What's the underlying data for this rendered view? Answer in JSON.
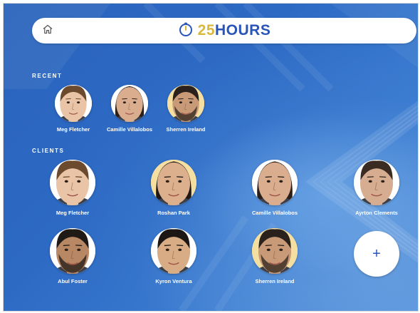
{
  "header": {
    "home_icon": "home-icon",
    "logo_icon": "stopwatch-icon",
    "brand_number": "25",
    "brand_word": "HOURS"
  },
  "recent": {
    "label": "RECENT",
    "people": [
      {
        "name": "Meg Fletcher",
        "bg": "#ffffff",
        "skin": "#e9c4a6",
        "hair": "#6b4a2e",
        "hair_style": "short"
      },
      {
        "name": "Camille Villalobos",
        "bg": "#ffffff",
        "skin": "#d9ad8e",
        "hair": "#2b2019",
        "hair_style": "long"
      },
      {
        "name": "Sherren Ireland",
        "bg": "#f5dfa0",
        "skin": "#c99a78",
        "hair": "#2a211c",
        "hair_style": "short-beard"
      }
    ]
  },
  "clients": {
    "label": "CLIENTS",
    "people": [
      {
        "name": "Meg Fletcher",
        "bg": "#ffffff",
        "skin": "#e9c4a6",
        "hair": "#6b4a2e",
        "hair_style": "short"
      },
      {
        "name": "Roshan Park",
        "bg": "#f5dfa0",
        "skin": "#dcb08c",
        "hair": "#1f1814",
        "hair_style": "long"
      },
      {
        "name": "Camille Villalobos",
        "bg": "#ffffff",
        "skin": "#d9ad8e",
        "hair": "#2b2019",
        "hair_style": "long"
      },
      {
        "name": "Ayrton Clements",
        "bg": "#ffffff",
        "skin": "#d6ad90",
        "hair": "#3a2c22",
        "hair_style": "short"
      },
      {
        "name": "Abul Foster",
        "bg": "#ffffff",
        "skin": "#b88764",
        "hair": "#1f1a16",
        "hair_style": "short-beard"
      },
      {
        "name": "Kyron Ventura",
        "bg": "#ffffff",
        "skin": "#d8ad86",
        "hair": "#1c1714",
        "hair_style": "short"
      },
      {
        "name": "Sherren Ireland",
        "bg": "#f5dfa0",
        "skin": "#c99a78",
        "hair": "#2a211c",
        "hair_style": "short-beard"
      }
    ],
    "add_label": "+",
    "add_icon": "plus-icon"
  },
  "colors": {
    "accent": "#2a55b8",
    "brand_gold": "#d9b83a",
    "background": "#2d6ac4"
  }
}
